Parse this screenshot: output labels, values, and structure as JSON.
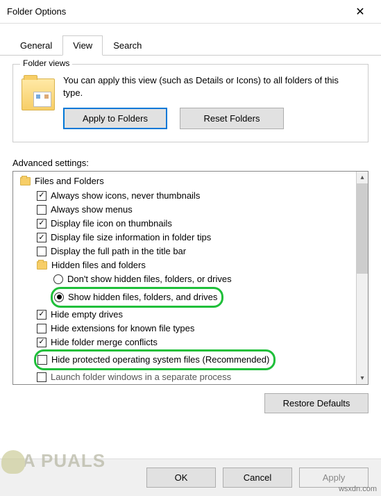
{
  "window": {
    "title": "Folder Options"
  },
  "tabs": {
    "general": "General",
    "view": "View",
    "search": "Search",
    "active": "view"
  },
  "folderViews": {
    "legend": "Folder views",
    "description": "You can apply this view (such as Details or Icons) to all folders of this type.",
    "applyBtn": "Apply to Folders",
    "resetBtn": "Reset Folders"
  },
  "advanced": {
    "label": "Advanced settings:",
    "rootLabel": "Files and Folders",
    "items": [
      {
        "type": "check",
        "checked": true,
        "label": "Always show icons, never thumbnails"
      },
      {
        "type": "check",
        "checked": false,
        "label": "Always show menus"
      },
      {
        "type": "check",
        "checked": true,
        "label": "Display file icon on thumbnails"
      },
      {
        "type": "check",
        "checked": true,
        "label": "Display file size information in folder tips"
      },
      {
        "type": "check",
        "checked": false,
        "label": "Display the full path in the title bar"
      },
      {
        "type": "folder",
        "label": "Hidden files and folders"
      },
      {
        "type": "radio",
        "checked": false,
        "indent": 3,
        "label": "Don't show hidden files, folders, or drives"
      },
      {
        "type": "radio",
        "checked": true,
        "indent": 3,
        "highlight": true,
        "label": "Show hidden files, folders, and drives"
      },
      {
        "type": "check",
        "checked": true,
        "label": "Hide empty drives"
      },
      {
        "type": "check",
        "checked": false,
        "label": "Hide extensions for known file types"
      },
      {
        "type": "check",
        "checked": true,
        "label": "Hide folder merge conflicts"
      },
      {
        "type": "check",
        "checked": false,
        "highlight": true,
        "label": "Hide protected operating system files (Recommended)"
      },
      {
        "type": "check-cut",
        "label": "Launch folder windows in a separate process"
      }
    ],
    "restoreBtn": "Restore Defaults"
  },
  "buttons": {
    "ok": "OK",
    "cancel": "Cancel",
    "apply": "Apply"
  },
  "watermark": "A   PUALS",
  "siteMark": "wsxdn.com"
}
